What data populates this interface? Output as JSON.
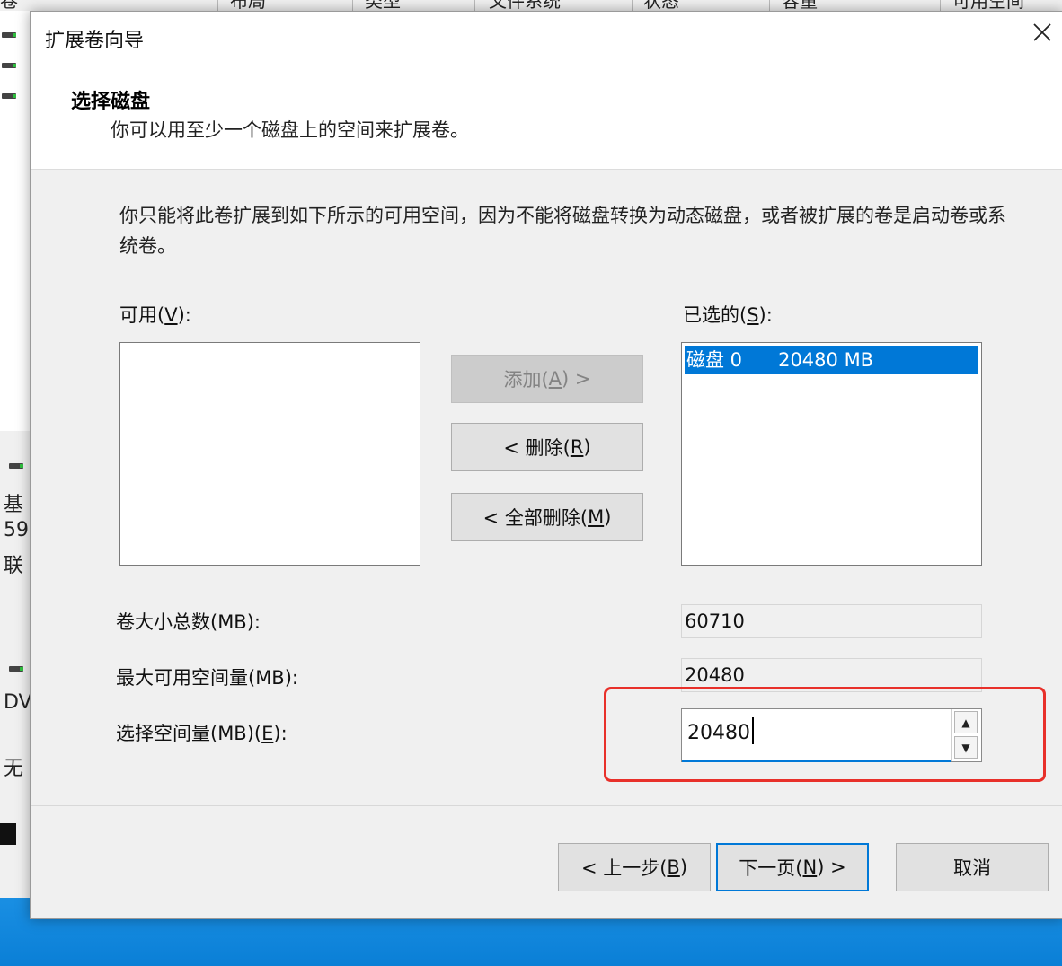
{
  "background": {
    "columns": [
      "卷",
      "布局",
      "类型",
      "文件系统",
      "状态",
      "容量",
      "可用空间"
    ],
    "side_texts": [
      "基",
      "59",
      "联",
      "DV",
      "无"
    ]
  },
  "dialog": {
    "title": "扩展卷向导",
    "section_title": "选择磁盘",
    "section_subtitle": "你可以用至少一个磁盘上的空间来扩展卷。",
    "description": "你只能将此卷扩展到如下所示的可用空间，因为不能将磁盘转换为动态磁盘，或者被扩展的卷是启动卷或系统卷。",
    "available_label": "可用(",
    "available_key": "V",
    "available_suffix": "):",
    "selected_label": "已选的(",
    "selected_key": "S",
    "selected_suffix": "):",
    "selected_items": [
      "磁盘 0      20480 MB"
    ],
    "add_button": {
      "prefix": "添加(",
      "key": "A",
      "suffix": ") >"
    },
    "remove_button": {
      "prefix": "< 删除(",
      "key": "R",
      "suffix": ")"
    },
    "remove_all_button": {
      "prefix": "< 全部删除(",
      "key": "M",
      "suffix": ")"
    },
    "total_size_label": "卷大小总数(MB):",
    "total_size_value": "60710",
    "max_space_label": "最大可用空间量(MB):",
    "max_space_value": "20480",
    "select_space_label_prefix": "选择空间量(MB)(",
    "select_space_key": "E",
    "select_space_label_suffix": "):",
    "select_space_value": "20480",
    "back_button": {
      "prefix": "< 上一步(",
      "key": "B",
      "suffix": ")"
    },
    "next_button": {
      "prefix": "下一页(",
      "key": "N",
      "suffix": ") >"
    },
    "cancel_button": "取消"
  },
  "colors": {
    "selection": "#0078d7",
    "highlight_box": "#e8302a"
  }
}
